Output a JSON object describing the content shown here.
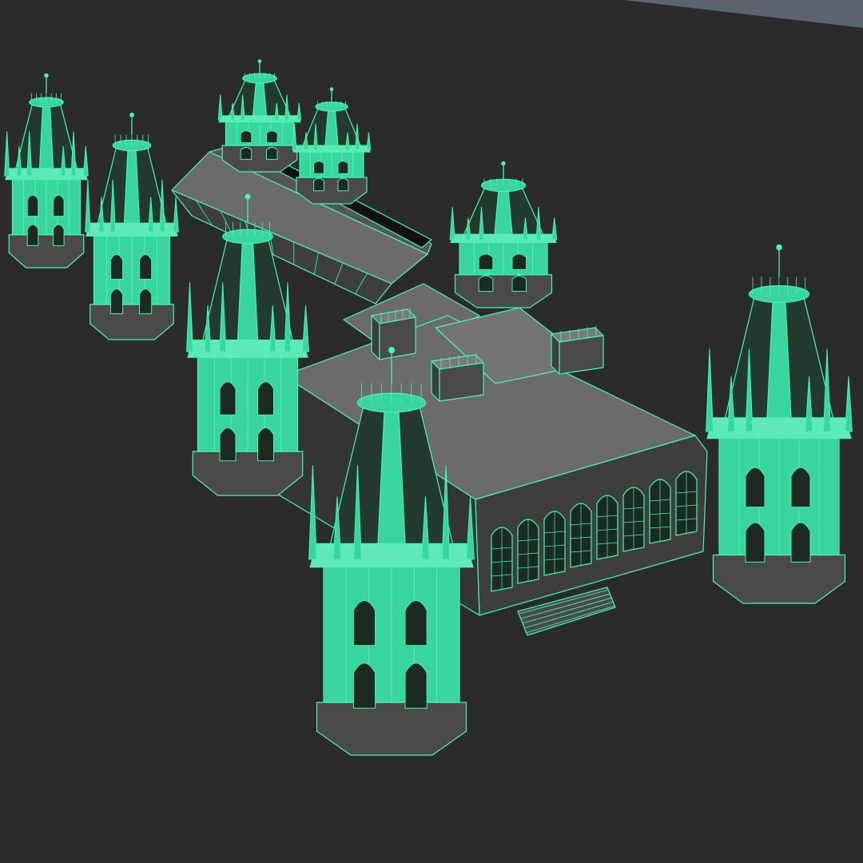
{
  "viewport": {
    "mode": "wireframe-on-shaded",
    "camera": "perspective"
  },
  "scene": {
    "subject": "palace model",
    "selection_state": "selected",
    "colors": {
      "background": "#2b2b2b",
      "sky": "#5c6470",
      "ground": "#2b2b2b",
      "wireframe_selected": "#45f5b4",
      "glow_fill": "#3ad4a0",
      "roof_shade": "#6b6b6b",
      "roof_dark": "#555555",
      "wall_dark": "#3e3e3e",
      "cone_dark": "#243a30",
      "window_dark": "#1c2a22"
    }
  }
}
